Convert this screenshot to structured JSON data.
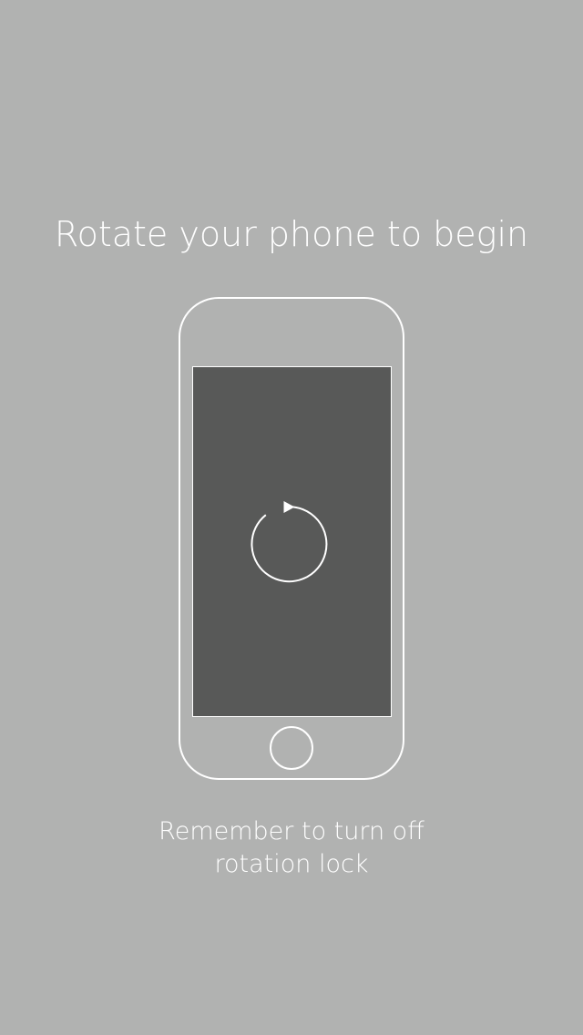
{
  "rotate_prompt": {
    "title": "Rotate your phone to begin",
    "message_line_1": "Remember to turn off",
    "message_line_2": "rotation lock",
    "icons": {
      "phone": "phone-outline-icon",
      "rotate": "rotate-counterclockwise-icon",
      "home_button": "home-button-icon"
    },
    "colors": {
      "background": "#b1b2b1",
      "screen": "#585958",
      "foreground": "#ffffff"
    }
  }
}
